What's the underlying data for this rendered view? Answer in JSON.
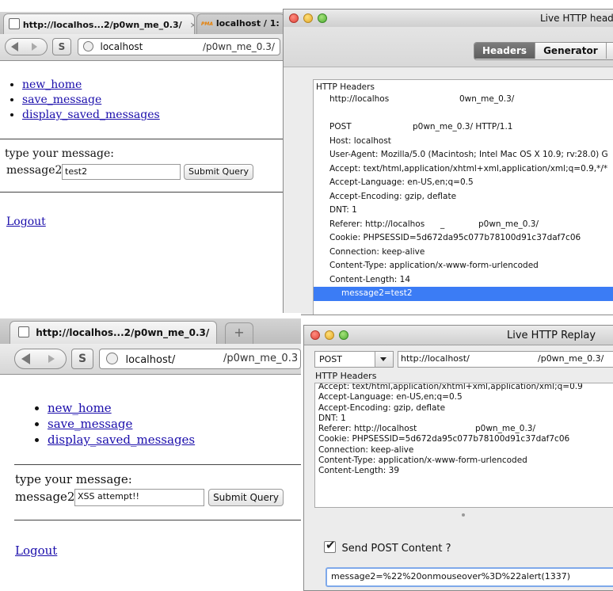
{
  "top_browser": {
    "tab1_title": "http://localhos...2/p0wn_me_0.3/",
    "tab1_close": "×",
    "tab2_title": "localhost / 1:",
    "tab2_favicon": "PMA",
    "url_host": "localhost",
    "url_path": "/p0wn_me_0.3/",
    "nav_links": [
      "new_home",
      "save_message",
      "display_saved_messages"
    ],
    "prompt": "type your message:",
    "field_label": "message2:",
    "field_value": "test2",
    "submit": "Submit Query",
    "logout": "Logout"
  },
  "live_headers": {
    "title": "Live HTTP head",
    "tabs": [
      "Headers",
      "Generator",
      "C"
    ],
    "active_tab": "Headers",
    "section_label": "HTTP Headers",
    "url_line": {
      "left": "http://localhos",
      "right": "0wn_me_0.3/"
    },
    "post_line": {
      "left": "POST",
      "right": "p0wn_me_0.3/ HTTP/1.1"
    },
    "lines": [
      "Host: localhost",
      "User-Agent: Mozilla/5.0 (Macintosh; Intel Mac OS X 10.9; rv:28.0) G",
      "Accept: text/html,application/xhtml+xml,application/xml;q=0.9,*/*",
      "Accept-Language: en-US,en;q=0.5",
      "Accept-Encoding: gzip, deflate",
      "DNT: 1"
    ],
    "referer_line": {
      "left": "Referer: http://localhos",
      "mid": "_",
      "right": "p0wn_me_0.3/"
    },
    "lines2": [
      "Cookie: PHPSESSID=5d672da95c077b78100d91c37daf7c06",
      "Connection: keep-alive",
      "Content-Type: application/x-www-form-urlencoded",
      "Content-Length: 14"
    ],
    "selected_line": "message2=test2"
  },
  "bottom_browser": {
    "tab_title": "http://localhos...2/p0wn_me_0.3/",
    "new_tab": "+",
    "url_host": "localhost/",
    "url_path": "/p0wn_me_0.3",
    "nav_links": [
      "new_home",
      "save_message",
      "display_saved_messages"
    ],
    "prompt": "type your message:",
    "field_label": "message2:",
    "field_value": "XSS attempt!!",
    "submit": "Submit Query",
    "logout": "Logout"
  },
  "live_replay": {
    "title": "Live HTTP Replay",
    "method": "POST",
    "url_left": "http://localhost/",
    "url_right": "/p0wn_me_0.3/",
    "section_label": "HTTP Headers",
    "lines": [
      "Accept: text/html,application/xhtml+xml,application/xml;q=0.9",
      "Accept-Language: en-US,en;q=0.5",
      "Accept-Encoding: gzip, deflate",
      "DNT: 1"
    ],
    "referer_line": {
      "left": "Referer: http://localhost",
      "right": "p0wn_me_0.3/"
    },
    "lines2": [
      "Cookie: PHPSESSID=5d672da95c077b78100d91c37daf7c06",
      "Connection: keep-alive",
      "Content-Type: application/x-www-form-urlencoded",
      "Content-Length: 39"
    ],
    "send_post_label": "Send POST Content ?",
    "send_post_checked": true,
    "post_content": "message2=%22%20onmouseover%3D%22alert(1337)"
  }
}
